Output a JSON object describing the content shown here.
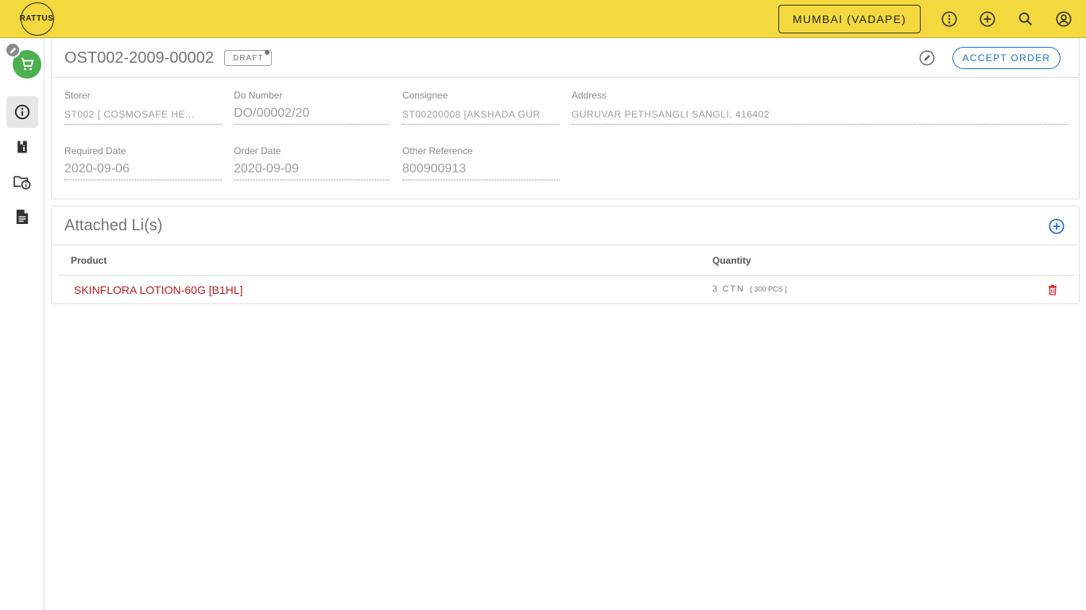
{
  "app": {
    "logo_text": "RATTUS",
    "location": "MUMBAI (VADAPE)",
    "brand_color": "#f4d93e"
  },
  "topbar": {
    "icons": [
      "more-vertical-icon",
      "add-circle-icon",
      "search-icon",
      "account-circle-icon"
    ]
  },
  "rail": {
    "items": [
      "info-icon",
      "info-document-icon",
      "folder-info-icon",
      "document-icon"
    ]
  },
  "order": {
    "id": "OST002-2009-00002",
    "status": "DRAFT",
    "accept_label": "ACCEPT ORDER",
    "fields": {
      "storer": {
        "label": "Storer",
        "value": "ST002 [ COSMOSAFE HE..."
      },
      "do_number": {
        "label": "Do Number",
        "value": "DO/00002/20"
      },
      "consignee": {
        "label": "Consignee",
        "value": "ST00200008 [AKSHADA GUR"
      },
      "address": {
        "label": "Address",
        "value": "GURUVAR PETHSANGLI SANGLI, 416402"
      },
      "required_date": {
        "label": "Required Date",
        "value": "2020-09-06"
      },
      "order_date": {
        "label": "Order Date",
        "value": "2020-09-09"
      },
      "other_reference": {
        "label": "Other Reference",
        "value": "800900913"
      }
    }
  },
  "lines": {
    "title": "Attached Li(s)",
    "columns": {
      "product": "Product",
      "quantity": "Quantity"
    },
    "rows": [
      {
        "product": "SKINFLORA LOTION-60G [B1HL]",
        "qty": "3 CTN",
        "qty_sub": "[ 300 PCS ]"
      }
    ]
  }
}
